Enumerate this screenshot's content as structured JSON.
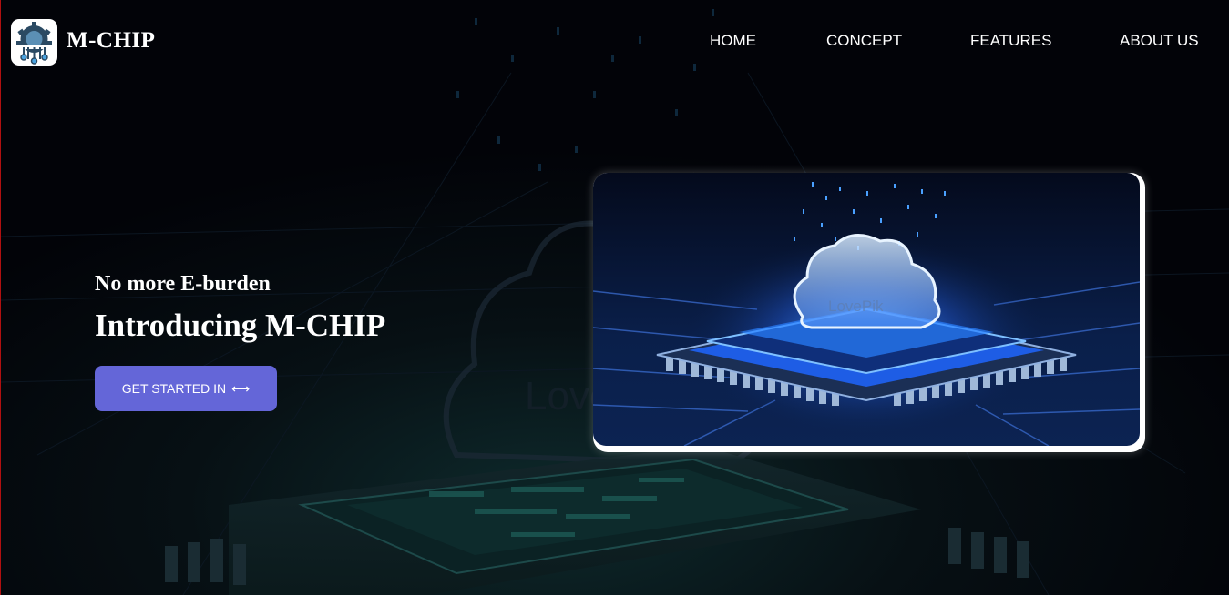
{
  "brand": {
    "name": "M-CHIP",
    "logo_icon": "chip-network-icon"
  },
  "nav": {
    "items": [
      {
        "label": "HOME"
      },
      {
        "label": "CONCEPT"
      },
      {
        "label": "FEATURES"
      },
      {
        "label": "ABOUT US"
      }
    ]
  },
  "hero": {
    "subtitle": "No more E-burden",
    "title": "Introducing M-CHIP",
    "cta_label": "GET STARTED IN",
    "cta_icon": "double-arrow-icon"
  },
  "hero_image": {
    "subject": "glowing cloud over processor chip",
    "watermark": "LovePik"
  },
  "colors": {
    "background": "#020308",
    "cta": "#6466d8",
    "glow": "#2a7bff"
  }
}
